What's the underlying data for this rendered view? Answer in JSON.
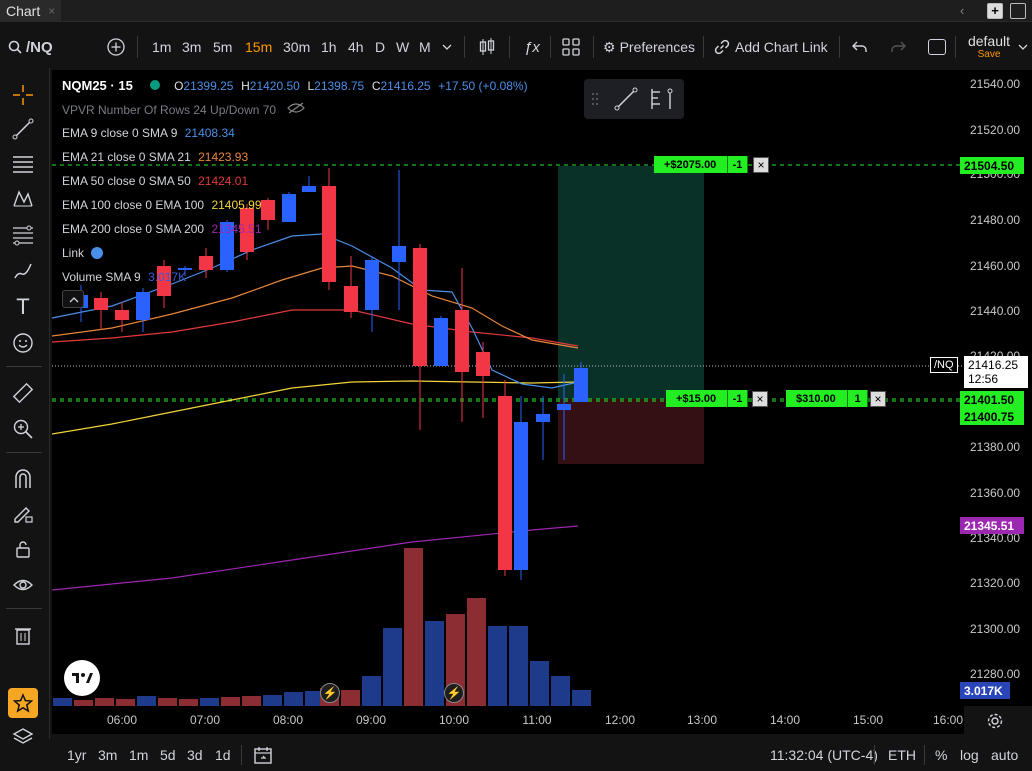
{
  "window": {
    "tab_title": "Chart",
    "tab_close": "×",
    "collapse": "‹"
  },
  "toolbar": {
    "symbol": "/NQ",
    "intervals": [
      "1m",
      "3m",
      "5m",
      "15m",
      "30m",
      "1h",
      "4h",
      "D",
      "W",
      "M"
    ],
    "active_interval": "15m",
    "preferences": "Preferences",
    "add_chart_link": "Add Chart Link",
    "layout_name": "default",
    "layout_save": "Save"
  },
  "legend": {
    "symbol_line": "NQM25 · 15",
    "o_label": "O",
    "o": "21399.25",
    "h_label": "H",
    "h": "21420.50",
    "l_label": "L",
    "l": "21398.75",
    "c_label": "C",
    "c": "21416.25",
    "change": "+17.50 (+0.08%)",
    "vpvr": "VPVR Number Of Rows 24 Up/Down 70",
    "ema9_label": "EMA 9 close 0 SMA 9",
    "ema9": "21408.34",
    "ema21_label": "EMA 21 close 0 SMA 21",
    "ema21": "21423.93",
    "ema50_label": "EMA 50 close 0 SMA 50",
    "ema50": "21424.01",
    "ema100_label": "EMA 100 close 0 EMA 100",
    "ema100": "21405.99",
    "ema200_label": "EMA 200 close 0 SMA 200",
    "ema200": "21345.51",
    "link": "Link",
    "volume_label": "Volume SMA 9",
    "volume": "3.017K"
  },
  "colors": {
    "ema9": "#4a8fe8",
    "ema21": "#e8863a",
    "ema50": "#e03a3a",
    "ema100": "#f2d43a",
    "ema200": "#9c27b0",
    "up": "#2962ff",
    "down": "#f23645",
    "green": "#22ee22"
  },
  "orders": {
    "target_pnl": "+$2075.00",
    "target_qty": "-1",
    "stop_pnl": "+$15.00",
    "stop_qty": "-1",
    "entry_pnl": "$310.00",
    "entry_qty": "1",
    "close": "×"
  },
  "price_axis": {
    "ticks": [
      "21540.00",
      "21520.00",
      "21500.00",
      "21480.00",
      "21460.00",
      "21440.00",
      "21420.00",
      "21400.00",
      "21380.00",
      "21360.00",
      "21340.00",
      "21320.00",
      "21300.00",
      "21280.00"
    ],
    "target_label": "21504.50",
    "symbol_tag": "/NQ",
    "last_price": "21416.25",
    "countdown": "12:56",
    "stop_label": "21401.50",
    "entry_label": "21400.75",
    "ema200_label": "21345.51",
    "volume_label": "3.017K"
  },
  "time_axis": {
    "ticks": [
      "06:00",
      "07:00",
      "08:00",
      "09:00",
      "10:00",
      "11:00",
      "12:00",
      "13:00",
      "14:00",
      "15:00",
      "16:00"
    ]
  },
  "bottom": {
    "ranges": [
      "1yr",
      "3m",
      "1m",
      "5d",
      "3d",
      "1d"
    ],
    "clock": "11:32:04 (UTC-4)",
    "session": "ETH",
    "percent": "%",
    "log": "log",
    "auto": "auto"
  }
}
